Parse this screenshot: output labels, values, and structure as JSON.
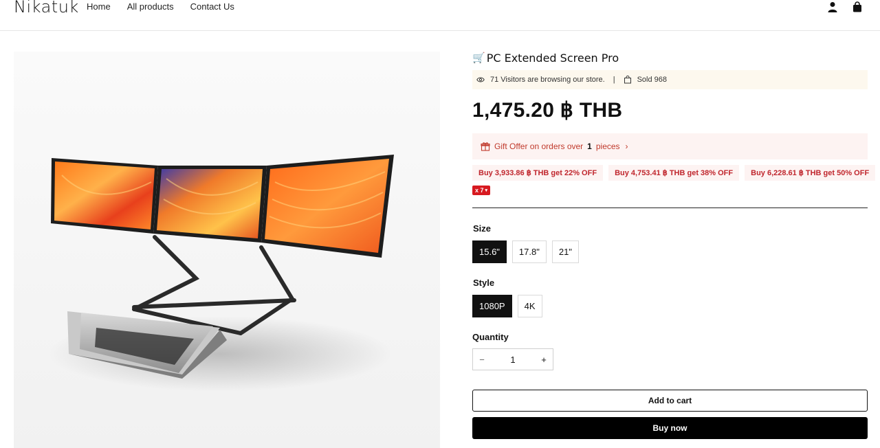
{
  "header": {
    "logo": "Nikatuk",
    "nav": [
      "Home",
      "All products",
      "Contact Us"
    ],
    "icons": [
      "user-icon",
      "shopping-bag-icon"
    ]
  },
  "product": {
    "title_prefix": "🛒",
    "title": "PC Extended Screen Pro",
    "visitors_text": "71 Visitors are browsing our store.",
    "separator": "|",
    "sold_text": "Sold 968",
    "price": "1,475.20 ฿ THB",
    "gift": {
      "text_before": "Gift Offer on orders over",
      "count": "1",
      "text_after": "pieces"
    },
    "discounts": [
      "Buy 3,933.86 ฿ THB get 22% OFF",
      "Buy 4,753.41 ฿ THB get 38% OFF",
      "Buy 6,228.61 ฿ THB get 50% OFF"
    ],
    "badge": "x 7",
    "size": {
      "label": "Size",
      "options": [
        "15.6\"",
        "17.8\"",
        "21\""
      ],
      "selected": "15.6\""
    },
    "style": {
      "label": "Style",
      "options": [
        "1080P",
        "4K"
      ],
      "selected": "1080P"
    },
    "quantity": {
      "label": "Quantity",
      "value": "1",
      "minus": "−",
      "plus": "+"
    },
    "add_to_cart": "Add to cart",
    "buy_now": "Buy now"
  },
  "colors": {
    "accent_red": "#d71920",
    "gift_bg": "#fdf3f2",
    "visitors_bg": "#fdf8ee",
    "primary": "#000000"
  }
}
